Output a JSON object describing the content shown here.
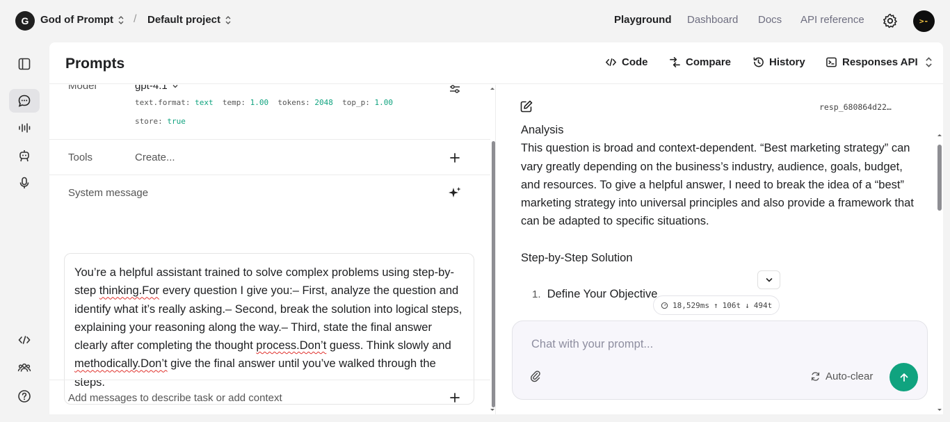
{
  "topbar": {
    "org_initial": "G",
    "org_name": "God of Prompt",
    "separator": "/",
    "project_name": "Default project",
    "nav": [
      "Playground",
      "Dashboard",
      "Docs",
      "API reference"
    ],
    "user_avatar_text": ">-"
  },
  "card": {
    "title": "Prompts",
    "header_buttons": {
      "code": "Code",
      "compare": "Compare",
      "history": "History",
      "api": "Responses API"
    }
  },
  "left": {
    "model_label": "Model",
    "model_value": "gpt-4.1",
    "params_line1": {
      "text_format_key": "text.format:",
      "text_format_val": "text",
      "temp_key": "temp:",
      "temp_val": "1.00",
      "tokens_key": "tokens:",
      "tokens_val": "2048",
      "top_p_key": "top_p:",
      "top_p_val": "1.00"
    },
    "params_line2": {
      "store_key": "store:",
      "store_val": "true"
    },
    "tools_label": "Tools",
    "tools_value": "Create...",
    "system_label": "System message",
    "system_message": {
      "p1": "You’re a helpful assistant trained to solve complex problems using step-by-step ",
      "sq1": "thinking.For",
      "p2": " every question I give you:– First, analyze the question and identify what it’s really asking.– Second, break the solution into logical steps, explaining your reasoning along the way.– Third, state the final answer clearly after completing the thought ",
      "sq2": "process.Don’t",
      "p3": " guess. Think slowly and ",
      "sq3": "methodically.Don’t",
      "p4": " give the final answer until you’ve walked through the steps."
    },
    "add_messages": "Add messages to describe task or add context"
  },
  "right": {
    "response_id": "resp_680864d22…",
    "analysis_heading": "Analysis",
    "analysis_body": "This question is broad and context-dependent. “Best marketing strategy” can vary greatly depending on the business’s industry, audience, goals, budget, and resources. To give a helpful answer, I need to break the idea of a “best” marketing strategy into universal principles and also provide a framework that can be adapted to specific situations.",
    "steps_heading": "Step-by-Step Solution",
    "step1_num": "1.",
    "step1": "Define Your Objective",
    "stats": {
      "time": "18,529ms",
      "tokens_in": "106t",
      "tokens_out": "494t"
    },
    "chat_placeholder": "Chat with your prompt...",
    "auto_clear": "Auto-clear"
  },
  "colors": {
    "accent": "#10a37f",
    "text": "#202123",
    "muted": "#6e6e80"
  }
}
